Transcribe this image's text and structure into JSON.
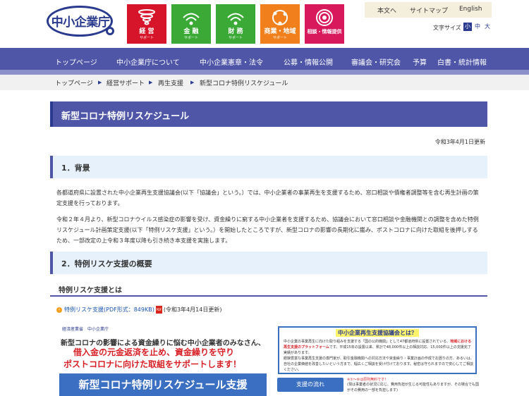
{
  "logo": {
    "text": "中小企業庁"
  },
  "tiles": [
    {
      "title": "経 営",
      "sub": "サポート",
      "color": "#d7152a",
      "icon": "tornado-icon"
    },
    {
      "title": "金 融",
      "sub": "サポート",
      "color": "#3aa935",
      "icon": "signal-waves-icon"
    },
    {
      "title": "財 務",
      "sub": "サポート",
      "color": "#3aa935",
      "icon": "signal-waves-icon"
    },
    {
      "title": "商業・地域",
      "sub": "サポート",
      "color": "#f07f1c",
      "icon": "orbit-icon"
    },
    {
      "title": "相談・情報提供",
      "sub": "",
      "color": "#d81a5d",
      "icon": "spiral-icon"
    }
  ],
  "utility": {
    "main_text": "本文へ",
    "sitemap": "サイトマップ",
    "english": "English"
  },
  "font_size": {
    "label": "文字サイズ",
    "small": "小",
    "medium": "中",
    "large": "大"
  },
  "nav": {
    "items": [
      "トップページ",
      "中小企業庁について",
      "中小企業憲章・法令",
      "公募・情報公開",
      "審議会・研究会",
      "予算",
      "白書・統計情報"
    ]
  },
  "breadcrumb": {
    "items": [
      "トップページ",
      "経営サポート",
      "再生支援",
      "新型コロナ特例リスケジュール"
    ]
  },
  "page": {
    "title": "新型コロナ特例リスケジュール",
    "updated": "令和3年4月1日更新"
  },
  "sections": {
    "background": {
      "heading": "1．背景",
      "p1": "各都道府県に設置された中小企業再生支援協議会(以下「協議会」という。）では、中小企業者の事業再生を支援するため、窓口相談や債権者調整等を含む再生計画の策定支援を行っております。",
      "p2": "令和２年４月より、新型コロナウイルス感染症の影響を受け、資金繰りに窮する中小企業者を支援するため、協議会において窓口相談や金融機関との調整を含めた特例リスケジュール計画策定支援(以下「特例リスケ支援」という。）を開始したところですが、新型コロナの影響の長期化に鑑み、ポストコロナに向けた取組を後押しするため、一部改定の上令和３年度以降も引き続き本支援を実施します。"
    },
    "overview": {
      "heading": "2．特例リスケ支援の概要",
      "subheading": "特例リスケ支援とは",
      "pdf_link": "特例リスケ支援(PDF形式：849KB)",
      "pdf_date": "(令和3年4月14日更新)"
    }
  },
  "flyer": {
    "logos": "経済産業省　中小企業庁",
    "line1": "新型コロナの影響による資金繰りに悩む中小企業者のみなさん、",
    "line2": "借入金の元金返済を止め、資金繰りを守り",
    "line3": "ポストコロナに向けた取組をサポートします！",
    "banner": "新型コロナ特例リスケジュール支援",
    "council_title": "中小企業再生支援協議会とは？",
    "council_body_1": "中小企業の事業再生に向けた取り組みを支援する「国の公的機関」として47都道府県に設置されている、",
    "council_body_hl": "地域における再生支援のプラットフォーム",
    "council_body_2": "です。平成15年の設置以来、累計で48,000件以上の相談対応、15,000件以上の支援完了実績があります。",
    "council_body_3": "経験豊富な事業再生支援の専門家が、取引金融機関への対応方法や資金繰り・事業計画の作成でお困りの方、あるいは、自社の企業価値を改善したいという方まで、幅広くご相談を受け付けております。秘密は守られますので安心してご相談ください。",
    "flow_button": "支援の流れ",
    "flow_note": "※①～⑥は原則無料です！",
    "flow_note2": "(現は事業者の状況に応じ、費用負担が生じる可能性もありますが、その場合でも国がその費用の一部を負担します)"
  }
}
